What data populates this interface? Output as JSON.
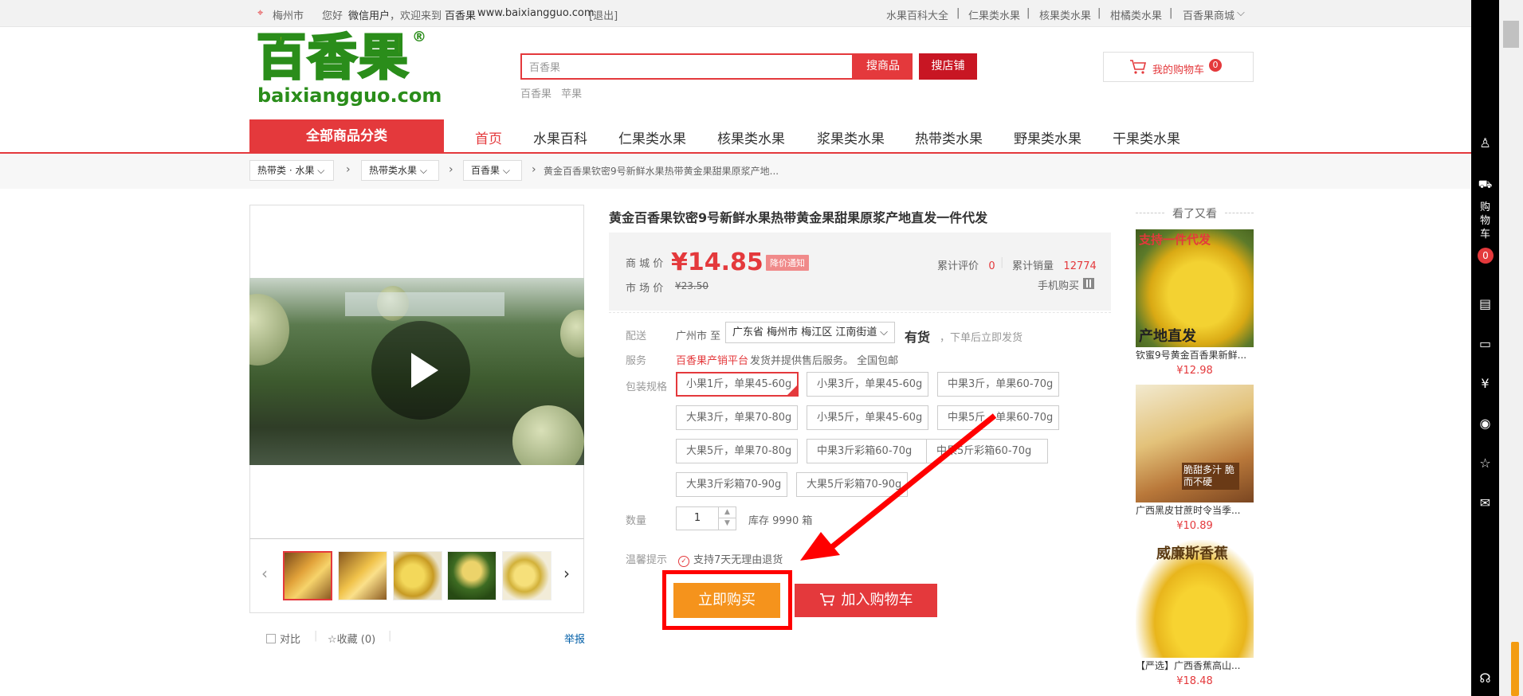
{
  "topbar": {
    "city": "梅州市",
    "greeting_prefix": "您好",
    "user": "微信用户",
    "welcome": "，欢迎来到",
    "site_name": "百香果",
    "site_url": "www.baixiangguo.com",
    "logout": "[退出]",
    "links": [
      "水果百科大全",
      "仁果类水果",
      "核果类水果",
      "柑橘类水果",
      "百香果商城"
    ]
  },
  "logo": {
    "cn": "百香果",
    "en": "baixiangguo.com",
    "registered": "®"
  },
  "search": {
    "value": "百香果",
    "btn_goods": "搜商品",
    "btn_store": "搜店铺",
    "hot": [
      "百香果",
      "苹果"
    ]
  },
  "cart": {
    "label": "我的购物车",
    "count": "0"
  },
  "nav": {
    "all_categories": "全部商品分类",
    "items": [
      "首页",
      "水果百科",
      "仁果类水果",
      "核果类水果",
      "浆果类水果",
      "热带类水果",
      "野果类水果",
      "干果类水果"
    ]
  },
  "breadcrumb": {
    "items": [
      "热带类 · 水果",
      "热带类水果",
      "百香果"
    ],
    "current": "黄金百香果钦密9号新鲜水果热带黄金果甜果原浆产地..."
  },
  "gallery": {
    "compare": "对比",
    "favorite": "收藏 (0)",
    "report": "举报"
  },
  "product": {
    "title": "黄金百香果钦密9号新鲜水果热带黄金果甜果原浆产地直发一件代发",
    "price_label": "商 城 价",
    "price": "¥14.85",
    "price_notice": "降价通知",
    "market_label": "市 场 价",
    "market_price": "¥23.50",
    "reviews_label": "累计评价",
    "reviews": "0",
    "sales_label": "累计销量",
    "sales": "12774",
    "mobile_buy": "手机购买",
    "delivery_label": "配送",
    "ship_from": "广州市 至",
    "region": "广东省 梅州市 梅江区 江南街道",
    "stock_status": "有货",
    "stock_note": "，下单后立即发货",
    "service_label": "服务",
    "service_link": "百香果产销平台",
    "service_text": "发货并提供售后服务。 全国包邮",
    "spec_label": "包装规格",
    "specs": [
      "小果1斤，单果45-60g",
      "小果3斤，单果45-60g",
      "中果3斤，单果60-70g",
      "大果3斤，单果70-80g",
      "小果5斤，单果45-60g",
      "中果5斤，单果60-70g",
      "大果5斤，单果70-80g",
      "中果3斤彩箱60-70g",
      "中果5斤彩箱60-70g",
      "大果3斤彩箱70-90g",
      "大果5斤彩箱70-90g"
    ],
    "selected_spec": "小果1斤，单果45-60g",
    "qty_label": "数量",
    "qty": "1",
    "inventory": "库存 9990 箱",
    "tip_label": "温馨提示",
    "tip": "支持7天无理由退货",
    "buy_now": "立即购买",
    "add_to_cart": "加入购物车"
  },
  "recommend": {
    "title": "看了又看",
    "items": [
      {
        "name": "钦蜜9号黄金百香果新鲜...",
        "price": "¥12.98",
        "overlay_top": "支持一件代发",
        "overlay_bottom": "产地直发"
      },
      {
        "name": "广西黑皮甘蔗时令当季...",
        "price": "¥10.89",
        "overlay_top": "",
        "overlay_bottom": "脆甜多汁 脆而不硬"
      },
      {
        "name": "【严选】广西香蕉高山...",
        "price": "¥18.48",
        "overlay_top": "威廉斯香蕉",
        "overlay_bottom": ""
      }
    ]
  },
  "sidebar": {
    "cart_label": "购物车",
    "cart_count": "0"
  },
  "colors": {
    "brand_red": "#e4393c",
    "buy_orange": "#f5931c",
    "highlight": "#ff0000"
  }
}
